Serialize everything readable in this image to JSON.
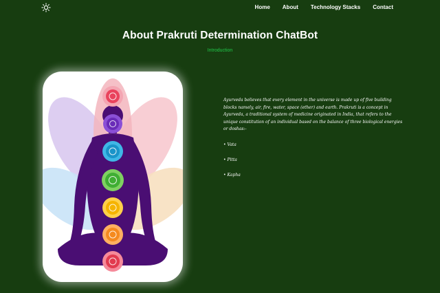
{
  "navbar": {
    "logo_icon": "sun-icon",
    "links": [
      {
        "label": "Home"
      },
      {
        "label": "About"
      },
      {
        "label": "Technology Stacks"
      },
      {
        "label": "Contact"
      }
    ]
  },
  "main": {
    "title": "About Prakruti Determination ChatBot",
    "subtitle": "Introduction",
    "image_icon": "meditation-chakra-illustration",
    "description": "Ayurveda believes that every element in the universe is made up of five building blocks namely, air, fire, water, space (ether) and earth. Prakruti is a concept in Ayurveda, a traditional system of medicine originated in India, that refers to the unique constitution of an individual based on the balance of three biological energies or doshas:-",
    "doshas": [
      "• Vata",
      "• Pitta",
      "• Kapha"
    ]
  },
  "colors": {
    "background": "#173d10",
    "accent": "#20c94a",
    "text": "#ffffff"
  }
}
